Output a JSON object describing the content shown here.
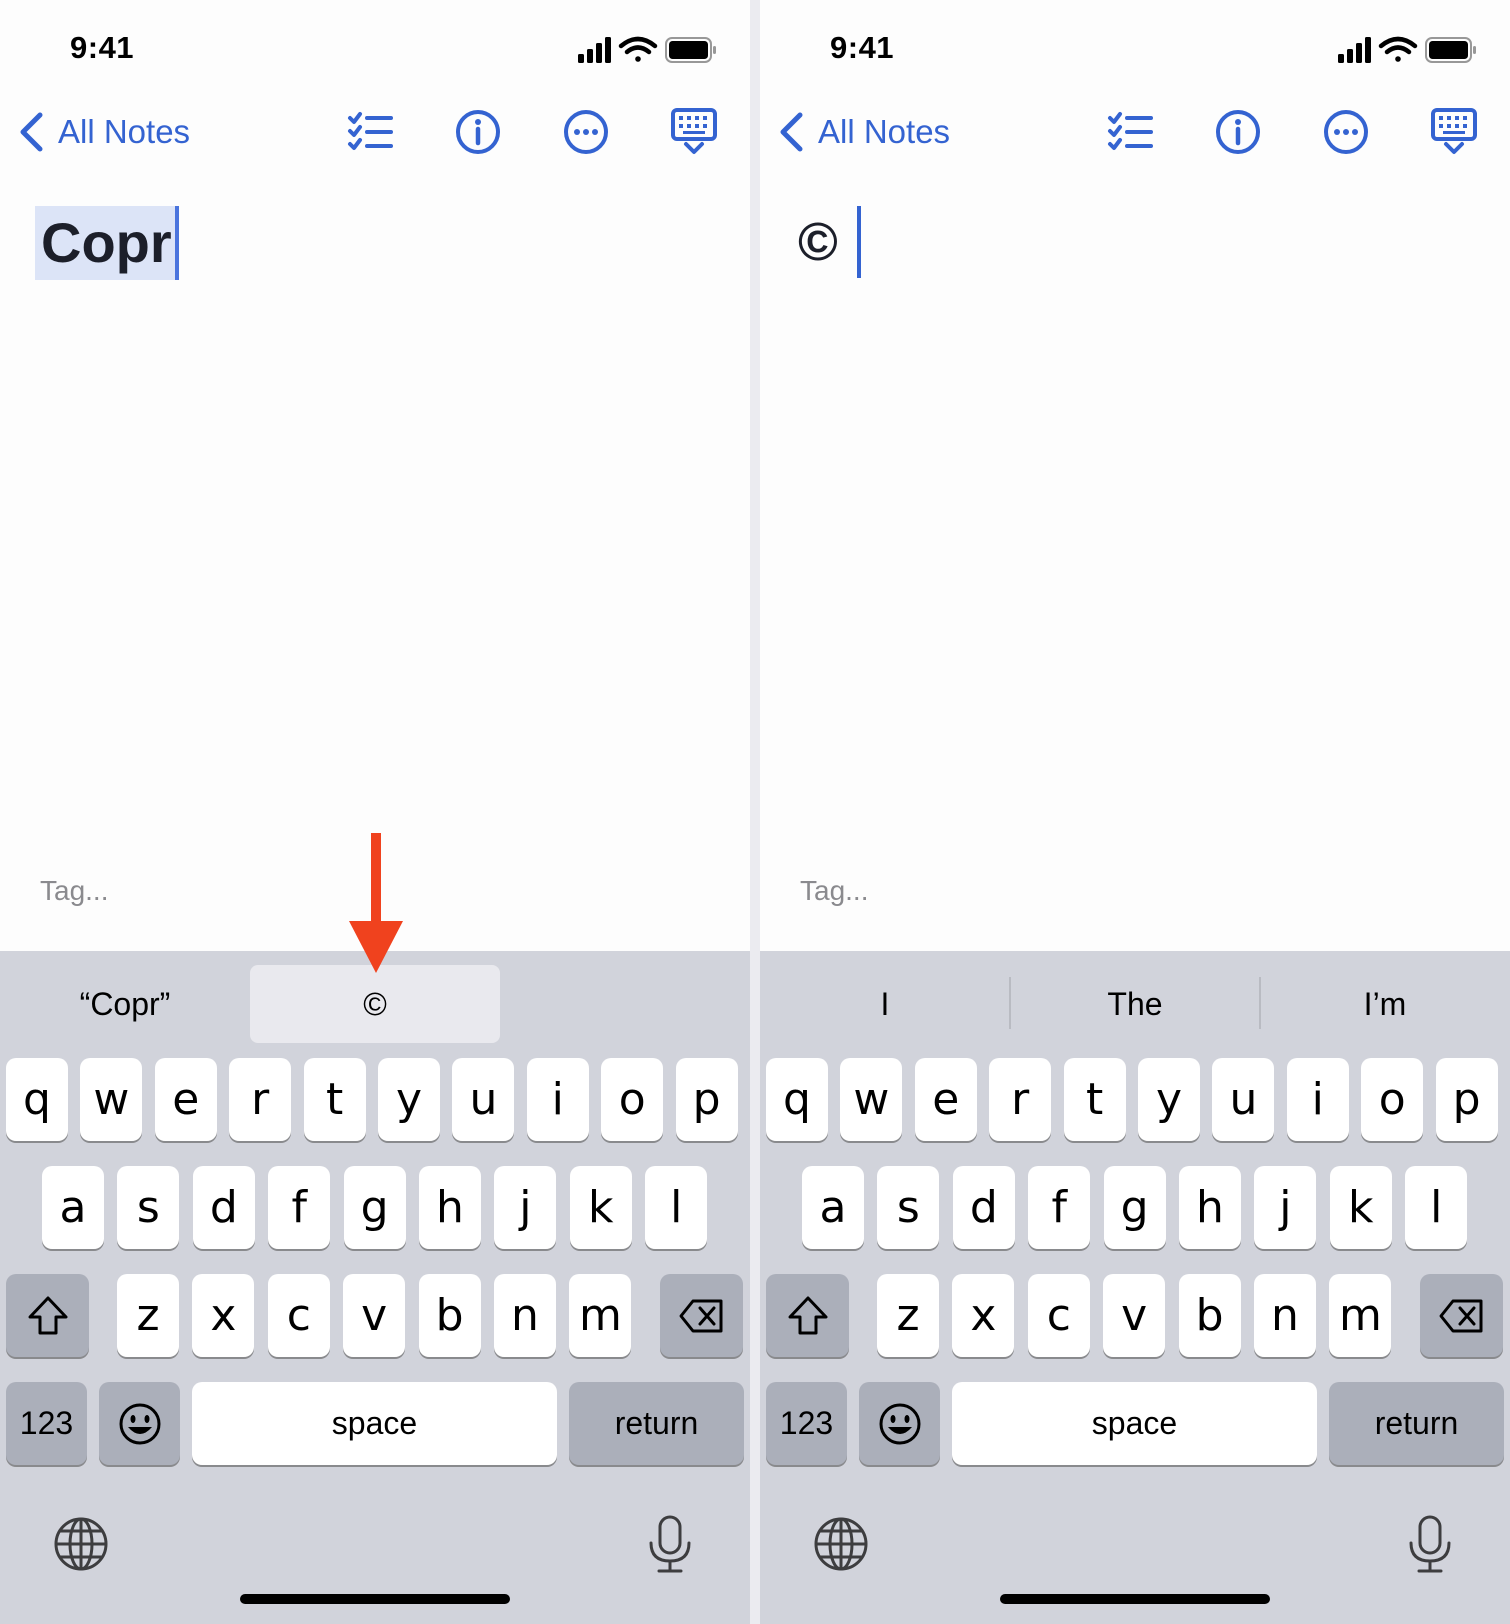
{
  "panels": [
    {
      "status": {
        "time": "9:41"
      },
      "nav": {
        "back_label": "All Notes"
      },
      "note": {
        "content": "Copr"
      },
      "tag": {
        "placeholder": "Tag..."
      },
      "predictions": [
        "“Copr”",
        "©",
        ""
      ],
      "predictions_active": 1,
      "keyboard": {
        "row1": [
          "q",
          "w",
          "e",
          "r",
          "t",
          "y",
          "u",
          "i",
          "o",
          "p"
        ],
        "row2": [
          "a",
          "s",
          "d",
          "f",
          "g",
          "h",
          "j",
          "k",
          "l"
        ],
        "row3": [
          "z",
          "x",
          "c",
          "v",
          "b",
          "n",
          "m"
        ],
        "numbers": "123",
        "space": "space",
        "return": "return"
      }
    },
    {
      "status": {
        "time": "9:41"
      },
      "nav": {
        "back_label": "All Notes"
      },
      "note": {
        "content": "©"
      },
      "tag": {
        "placeholder": "Tag..."
      },
      "predictions": [
        "I",
        "The",
        "I’m"
      ],
      "predictions_active": -1,
      "keyboard": {
        "row1": [
          "q",
          "w",
          "e",
          "r",
          "t",
          "y",
          "u",
          "i",
          "o",
          "p"
        ],
        "row2": [
          "a",
          "s",
          "d",
          "f",
          "g",
          "h",
          "j",
          "k",
          "l"
        ],
        "row3": [
          "z",
          "x",
          "c",
          "v",
          "b",
          "n",
          "m"
        ],
        "numbers": "123",
        "space": "space",
        "return": "return"
      }
    }
  ],
  "icons": {
    "nav": [
      "checklist-icon",
      "info-icon",
      "more-icon",
      "keyboard-dismiss-icon"
    ],
    "keyboard": [
      "shift-icon",
      "delete-icon",
      "emoji-icon",
      "globe-icon",
      "microphone-icon"
    ]
  },
  "colors": {
    "accent": "#3463d1",
    "annotation_arrow": "#f0421e",
    "keyboard_bg": "#d1d3db"
  }
}
